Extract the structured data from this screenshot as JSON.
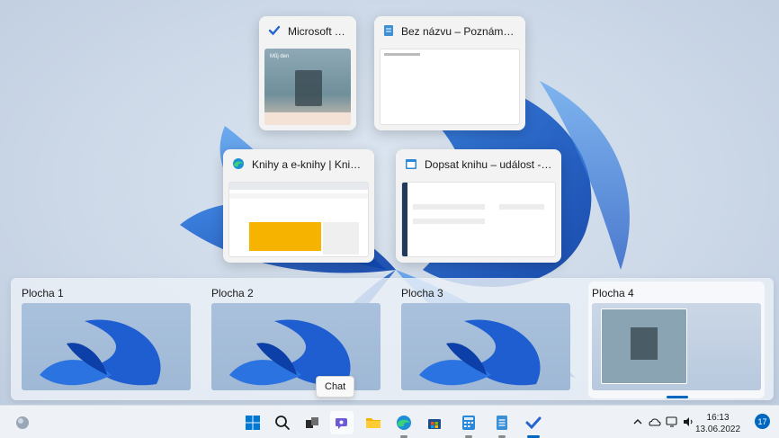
{
  "windows": [
    {
      "title": "Microsoft To Do",
      "icon": "check-icon"
    },
    {
      "title": "Bez názvu – Poznámkový blok",
      "icon": "notepad-icon"
    },
    {
      "title": "Knihy a e-knihy | Knihy Grada...",
      "icon": "edge-icon"
    },
    {
      "title": "Dopsat knihu – událost - Kalendář",
      "icon": "calendar-icon"
    }
  ],
  "todo_thumb": {
    "heading": "Můj den"
  },
  "desktops": [
    {
      "label": "Plocha 1"
    },
    {
      "label": "Plocha 2"
    },
    {
      "label": "Plocha 3"
    },
    {
      "label": "Plocha 4"
    }
  ],
  "tooltip": {
    "text": "Chat"
  },
  "taskbar": {
    "icons": [
      "widgets-icon",
      "start-icon",
      "search-icon",
      "task-view-icon",
      "chat-icon",
      "file-explorer-icon",
      "edge-icon",
      "store-icon",
      "calculator-icon",
      "notepad-icon",
      "todo-icon"
    ]
  },
  "clock": {
    "time": "16:13",
    "date": "13.06.2022"
  },
  "notifications": {
    "count": "17"
  },
  "colors": {
    "accent": "#0067c0",
    "bloom_dark": "#0a3fa8",
    "bloom_light": "#3d8ae6"
  }
}
